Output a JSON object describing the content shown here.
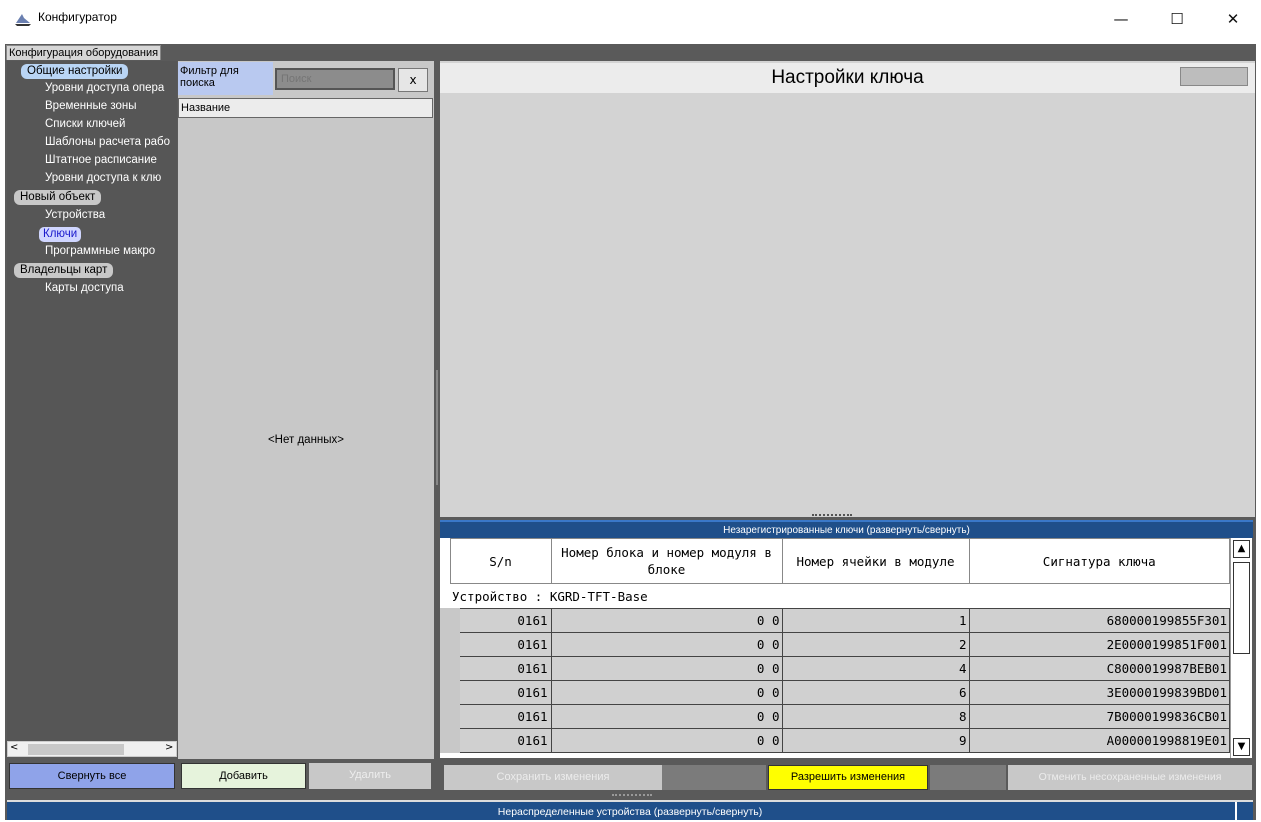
{
  "window": {
    "title": "Конфигуратор",
    "minimize": "—",
    "maximize": "☐",
    "close": "✕"
  },
  "tab": {
    "label": "Конфигурация оборудования"
  },
  "nav": {
    "groups": [
      {
        "label": "Общие настройки",
        "items": [
          "Уровни доступа опера",
          "Временные зоны",
          "Списки ключей",
          "Шаблоны расчета рабо",
          "Штатное расписание",
          "Уровни доступа к клю"
        ]
      },
      {
        "label": "Новый объект",
        "items": [
          "Устройства",
          "Ключи",
          "Программные макро"
        ]
      },
      {
        "label": "Владельцы карт",
        "items": [
          "Карты доступа"
        ]
      }
    ],
    "selected": "Ключи",
    "collapse_all": "Свернуть все"
  },
  "list": {
    "filter_label": "Фильтр для поиска",
    "search_placeholder": "Поиск",
    "clear": "x",
    "column": "Название",
    "empty": "<Нет данных>",
    "add": "Добавить",
    "delete": "Удалить"
  },
  "settings": {
    "title": "Настройки ключа"
  },
  "keys": {
    "header": "Незарегистрированные ключи (развернуть/свернуть)",
    "columns": [
      "S/n",
      "Номер блока и номер модуля в блоке",
      "Номер ячейки в модуле",
      "Сигнатура ключа"
    ],
    "group": "Устройство : KGRD-TFT-Base",
    "rows": [
      {
        "sn": "0161",
        "block": "0 0",
        "cell": "1",
        "sig": "680000199855F301"
      },
      {
        "sn": "0161",
        "block": "0 0",
        "cell": "2",
        "sig": "2E0000199851F001"
      },
      {
        "sn": "0161",
        "block": "0 0",
        "cell": "4",
        "sig": "C8000019987BEB01"
      },
      {
        "sn": "0161",
        "block": "0 0",
        "cell": "6",
        "sig": "3E0000199839BD01"
      },
      {
        "sn": "0161",
        "block": "0 0",
        "cell": "8",
        "sig": "7B0000199836CB01"
      },
      {
        "sn": "0161",
        "block": "0 0",
        "cell": "9",
        "sig": "A000001998819E01"
      }
    ]
  },
  "actions": {
    "save": "Сохранить изменения",
    "allow": "Разрешить изменения",
    "cancel": "Отменить несохраненные изменения"
  },
  "footer": {
    "label": "Нераспределенные устройства (развернуть/свернуть)"
  }
}
